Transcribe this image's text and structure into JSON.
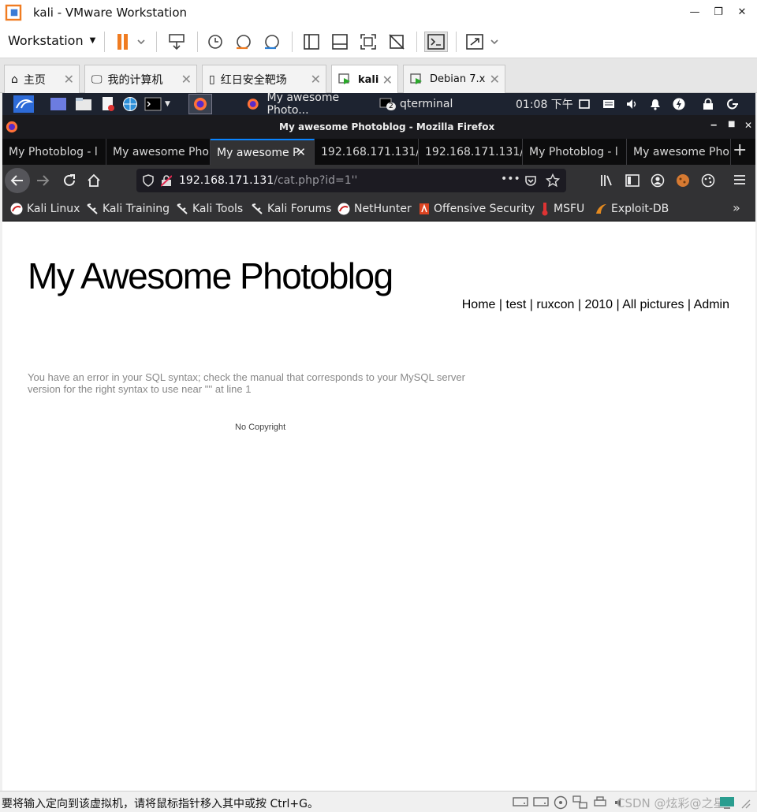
{
  "vmware": {
    "window_title": "kali - VMware Workstation",
    "menu_label": "Workstation",
    "tabs": [
      {
        "label": "主页"
      },
      {
        "label": "我的计算机"
      },
      {
        "label": "红日安全靶场"
      },
      {
        "label": "kali"
      },
      {
        "label": "Debian 7.x"
      }
    ],
    "status_text": "要将输入定向到该虚拟机，请将鼠标指针移入其中或按 Ctrl+G。",
    "watermark": "CSDN @炫彩@之星"
  },
  "kali_panel": {
    "taskbar_firefox": "My awesome Photo...",
    "taskbar_terminal": "qterminal",
    "terminal_count": "2",
    "clock": "01:08 下午"
  },
  "firefox": {
    "window_title": "My awesome Photoblog - Mozilla Firefox",
    "tabs": [
      {
        "label": "My Photoblog - l"
      },
      {
        "label": "My awesome Pho"
      },
      {
        "label": "My awesome P"
      },
      {
        "label": "192.168.171.131/"
      },
      {
        "label": "192.168.171.131/"
      },
      {
        "label": "My Photoblog - l"
      },
      {
        "label": "My awesome Pho"
      }
    ],
    "url_host": "192.168.171.131",
    "url_path": "/cat.php?id=1''",
    "url_menu": "•••",
    "bookmarks": [
      {
        "label": "Kali Linux"
      },
      {
        "label": "Kali Training"
      },
      {
        "label": "Kali Tools"
      },
      {
        "label": "Kali Forums"
      },
      {
        "label": "NetHunter"
      },
      {
        "label": "Offensive Security"
      },
      {
        "label": "MSFU"
      },
      {
        "label": "Exploit-DB"
      }
    ]
  },
  "page": {
    "title": "My Awesome Photoblog",
    "nav": [
      "Home",
      "test",
      "ruxcon",
      "2010",
      "All pictures",
      "Admin"
    ],
    "nav_sep": "|",
    "error": "You have an error in your SQL syntax; check the manual that corresponds to your MySQL server version for the right syntax to use near \"'' at line 1",
    "footer": "No Copyright"
  },
  "colors": {
    "kali_panel": "#1d2330",
    "firefox_dark": "#323234",
    "tab_highlight": "#0a84ff",
    "vmware_orange": "#f07c21"
  }
}
